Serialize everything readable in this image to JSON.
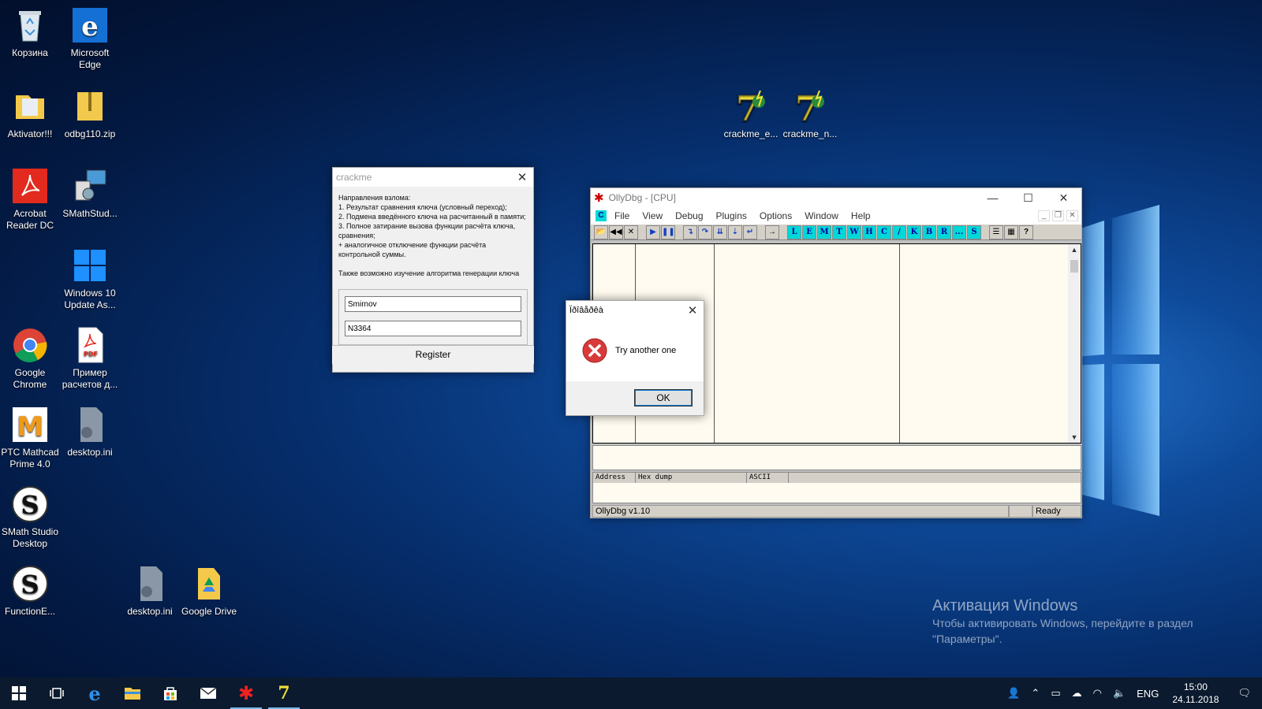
{
  "desktop": {
    "icons": [
      {
        "label": "Корзина"
      },
      {
        "label": "Microsoft Edge"
      },
      {
        "label": "Aktivator!!!"
      },
      {
        "label": "odbg110.zip"
      },
      {
        "label": "Acrobat Reader DC"
      },
      {
        "label": "SMathStud..."
      },
      {
        "label": "Windows 10 Update As..."
      },
      {
        "label": "Google Chrome"
      },
      {
        "label": "Пример расчетов д..."
      },
      {
        "label": "PTC Mathcad Prime 4.0"
      },
      {
        "label": "desktop.ini"
      },
      {
        "label": "SMath Studio Desktop"
      },
      {
        "label": "FunctionE..."
      },
      {
        "label": "desktop.ini"
      },
      {
        "label": "Google Drive"
      },
      {
        "label": "crackme_e..."
      },
      {
        "label": "crackme_n..."
      }
    ]
  },
  "crackme": {
    "title": "crackme",
    "description": "Направления взлома:\n1. Результат сравнения ключа (условный переход);\n2. Подмена введённого ключа на расчитанный в памяти;\n3. Полное затирание вызова функции расчёта ключа, сравнения;\n+ аналогичное отключение функции расчёта контрольной суммы.\n\nТакже возможно изучение алгоритма генерации ключа",
    "name_value": "Smirnov",
    "key_value": "N3364",
    "register_label": "Register"
  },
  "olly": {
    "title": "OllyDbg - [CPU]",
    "menu": [
      "File",
      "View",
      "Debug",
      "Plugins",
      "Options",
      "Window",
      "Help"
    ],
    "toolbar_letters": [
      "L",
      "E",
      "M",
      "T",
      "W",
      "H",
      "C",
      "/",
      "K",
      "B",
      "R",
      "...",
      "S"
    ],
    "dump_headers": [
      "Address",
      "Hex dump",
      "ASCII"
    ],
    "status_left": "OllyDbg v1.10",
    "status_right": "Ready"
  },
  "msgbox": {
    "title": "Ïðîâåðêà",
    "message": "Try another one",
    "ok_label": "OK"
  },
  "activation": {
    "heading": "Активация Windows",
    "text": "Чтобы активировать Windows, перейдите в раздел \"Параметры\"."
  },
  "taskbar": {
    "lang": "ENG",
    "time": "15:00",
    "date": "24.11.2018"
  },
  "colors": {
    "accent": "#0078d7",
    "olly_cyan": "#00d8d8",
    "cpu_bg": "#fffbf0"
  }
}
